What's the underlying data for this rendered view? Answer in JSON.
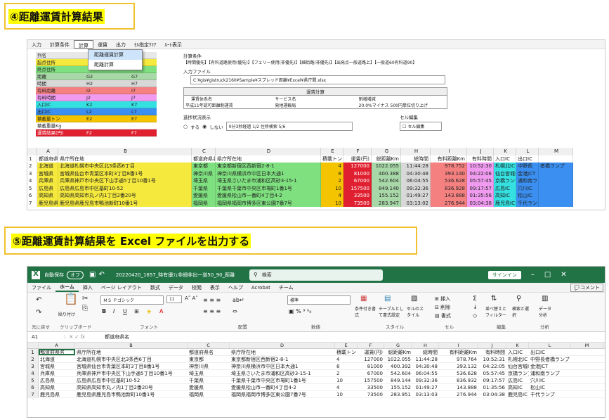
{
  "header1": "④距離運賃計算結果",
  "header2": "⑤距離運賃計算結果を Excel ファイルを出力する",
  "app1": {
    "menu": [
      "入力",
      "計算条件",
      "計算",
      "運賃",
      "出力",
      "ｾﾙ指定ｸﾘｱ",
      "ﾙｰﾄ表示"
    ],
    "menu_selected": "計算",
    "dropdown": [
      "距離運賃計算",
      "距離計算"
    ],
    "legend_header": [
      "列名",
      "",
      ""
    ],
    "legend_rows": [
      {
        "name": "起点住所",
        "c1": "",
        "c2": "",
        "color": "#f5e93e"
      },
      {
        "name": "終点住所",
        "c1": "",
        "c2": "",
        "color": "#7fe07f"
      },
      {
        "name": "距離",
        "c1": "G2",
        "c2": "G7",
        "color": "#a8d8a8"
      },
      {
        "name": "時間",
        "c1": "H2",
        "c2": "H7",
        "color": "#d8d8d8"
      },
      {
        "name": "有料距離",
        "c1": "I2",
        "c2": "I7",
        "color": "#f58080"
      },
      {
        "name": "有料時間",
        "c1": "J2",
        "c2": "J7",
        "color": "#f09bf0"
      },
      {
        "name": "入口IC",
        "c1": "K2",
        "c2": "K7",
        "color": "#34e0e0"
      },
      {
        "name": "出口IC",
        "c1": "L2",
        "c2": "L7",
        "color": "#3a8ff0"
      },
      {
        "name": "積載量トン",
        "c1": "E2",
        "c2": "E7",
        "color": "#f5c400"
      },
      {
        "name": "積載重量Kg",
        "c1": "",
        "c2": "",
        "color": "#ffffff"
      },
      {
        "name": "運賃結果(円)",
        "c1": "F2",
        "c2": "F7",
        "color": "#e02030"
      }
    ],
    "cond_label": "計算条件",
    "cond_text": "【時間優先】【有料道路使用(優先)】【フェリー使用(非優先)】【細街路(非優先)】【出発点一般道路上】【一般道60有料道90】",
    "file_label": "入力ファイル",
    "file_path": "C:¥gis¥gistruck2160¥Sample¥スプレッド距離¥Excel¥県庁間.xlsx",
    "fare_title": "運賃計算",
    "fare_headers": [
      "運賃体系名",
      "サービス名",
      "割増増減"
    ],
    "fare_values": [
      "平成11年認可距離制運賃",
      "発地運輸局",
      "20.0%マイナス 500円単位切り上げ"
    ],
    "progress_label": "進捗状況表示",
    "radio_yes": "する",
    "radio_no": "しない",
    "progress_text": "0分3秒経過 1/2 住所検索 5/6",
    "cell_label": "セル編集",
    "cell_check": "セル編集",
    "col_letters": [
      "",
      "A",
      "B",
      "C",
      "D",
      "E",
      "F",
      "G",
      "H",
      "I",
      "J",
      "K",
      "L",
      "M"
    ],
    "sheet_header": [
      "1",
      "都道府県名",
      "県庁所在地",
      "都道府県名",
      "県庁所在地",
      "積載トン",
      "運賃(円)",
      "総距離Km",
      "総時間",
      "有料距離Km",
      "有料時間",
      "入口IC",
      "出口IC",
      ""
    ],
    "rows": [
      [
        "2",
        "北海道",
        "北海道札幌市中央区北3条西6丁目",
        "東京都",
        "東京都新宿区西新宿2-8-1",
        "4",
        "127000",
        "1022.055",
        "11:44:28",
        "978.752",
        "10:52:30",
        "札幌北IC",
        "中野長",
        "者橋ランプ"
      ],
      [
        "3",
        "宮城県",
        "宮城県仙台市青葉区本町3丁目8番1号",
        "神奈川県",
        "神奈川県横浜市中区日本大通1",
        "8",
        "81000",
        "400.388",
        "04:30:48",
        "393.140",
        "04:22:06",
        "仙台宮城IC",
        "金港JCT",
        ""
      ],
      [
        "4",
        "兵庫県",
        "兵庫県神戸市中央区下山手通5丁目10番1号",
        "埼玉県",
        "埼玉県さいたま市浦和区高砂3-15-1",
        "2",
        "67000",
        "542.604",
        "06:04:55",
        "536.628",
        "05:57:45",
        "京橋ランプ",
        "浦和南ランプ",
        ""
      ],
      [
        "5",
        "広島県",
        "広島県広島市中区基町10-52",
        "千葉県",
        "千葉県千葉市中央区市場町1番1号",
        "10",
        "157500",
        "849.140",
        "09:32:36",
        "836.928",
        "09:17:57",
        "広島IC",
        "穴川IC",
        ""
      ],
      [
        "6",
        "高知県",
        "高知県高知市丸ノ内1丁目2番20号",
        "愛媛県",
        "愛媛県松山市一番町4丁目4-2",
        "4",
        "33500",
        "155.152",
        "01:49:27",
        "143.888",
        "01:35:56",
        "高知IC",
        "松山IC",
        ""
      ],
      [
        "7",
        "鹿児島県",
        "鹿児島県鹿児島市鴨池新町10番1号",
        "福岡県",
        "福岡県福岡市博多区東公園7番7号",
        "10",
        "73500",
        "283.947",
        "03:13:02",
        "276.944",
        "03:04:38",
        "鹿児島IC",
        "千代ランプ",
        ""
      ]
    ]
  },
  "excel": {
    "autosave": "自動保存",
    "autosave_state": "オフ",
    "filename": "20220420_1657_時有優ﾌｪ非細非出一道50_90_距離",
    "search": "検索",
    "signin": "サインイン",
    "tabs": [
      "ファイル",
      "ホーム",
      "挿入",
      "ページ レイアウト",
      "数式",
      "データ",
      "校閲",
      "表示",
      "ヘルプ",
      "Acrobat",
      "チーム"
    ],
    "active_tab": "ホーム",
    "comment_btn": "コメント",
    "font_name": "ＭＳ Ｐゴシック",
    "font_size": "11",
    "number_format": "標準",
    "groups": [
      "元に戻す",
      "クリップボード",
      "フォント",
      "配置",
      "数値",
      "スタイル",
      "セル",
      "編集",
      "分析"
    ],
    "ribbon_labels": {
      "paste": "貼り付け",
      "cond": "条件付き書式",
      "table": "テーブルとして書式設定",
      "cellstyle": "セルのスタイル",
      "insert": "挿入",
      "delete": "削除",
      "format": "書式",
      "sort": "並べ替えとフィルター",
      "find": "検索と選択",
      "analyze": "データ分析"
    },
    "cell_ref": "A1",
    "formula": "都道府県名",
    "col_letters": [
      "",
      "A",
      "B",
      "C",
      "D",
      "E",
      "F",
      "G",
      "H",
      "I",
      "J",
      "K",
      "L",
      "M"
    ],
    "header": [
      "1",
      "都道府県名",
      "県庁所在地",
      "都道府県名",
      "県庁所在地",
      "積載トン",
      "運賃(円)",
      "総距離Km",
      "総時間",
      "有料距離Km",
      "有料時間",
      "入口IC",
      "出口IC",
      ""
    ],
    "rows": [
      [
        "2",
        "北海道",
        "北海道札幌市中央区北3条西6丁目",
        "東京都",
        "東京都新宿区西新宿2-8-1",
        "4",
        "127000",
        "1022.055",
        "11:44:28",
        "978.764",
        "10:52:31",
        "札幌北IC",
        "中野長者橋ランプ",
        ""
      ],
      [
        "3",
        "宮城県",
        "宮城県仙台市青葉区本町3丁目8番1号",
        "神奈川県",
        "神奈川県横浜市中区日本大通1",
        "8",
        "81000",
        "400.392",
        "04:30:48",
        "393.132",
        "04:22:05",
        "仙台宮城IC",
        "金港JCT",
        ""
      ],
      [
        "4",
        "兵庫県",
        "兵庫県神戸市中央区下山手通5丁目10番1号",
        "埼玉県",
        "埼玉県さいたま市浦和区高砂3-15-1",
        "2",
        "67000",
        "542.604",
        "06:04:55",
        "536.628",
        "05:57:45",
        "京橋ランプ",
        "浦和南ランプ",
        ""
      ],
      [
        "5",
        "広島県",
        "広島県広島市中区基町10-52",
        "千葉県",
        "千葉県千葉市中央区市場町1番1号",
        "10",
        "157500",
        "849.144",
        "09:32:36",
        "836.932",
        "09:17:57",
        "広島IC",
        "穴川IC",
        ""
      ],
      [
        "6",
        "高知県",
        "高知県高知市丸ノ内1丁目2番20号",
        "愛媛県",
        "愛媛県松山市一番町4丁目4-2",
        "4",
        "33500",
        "155.152",
        "01:49:27",
        "143.888",
        "01:35:56",
        "高知IC",
        "松山IC",
        ""
      ],
      [
        "7",
        "鹿児島県",
        "鹿児島県鹿児島市鴨池新町10番1号",
        "福岡県",
        "福岡県福岡市博多区東公園7番7号",
        "10",
        "73500",
        "283.951",
        "03:13:03",
        "276.944",
        "03:04:38",
        "鹿児島IC",
        "千代ランプ",
        ""
      ]
    ]
  }
}
